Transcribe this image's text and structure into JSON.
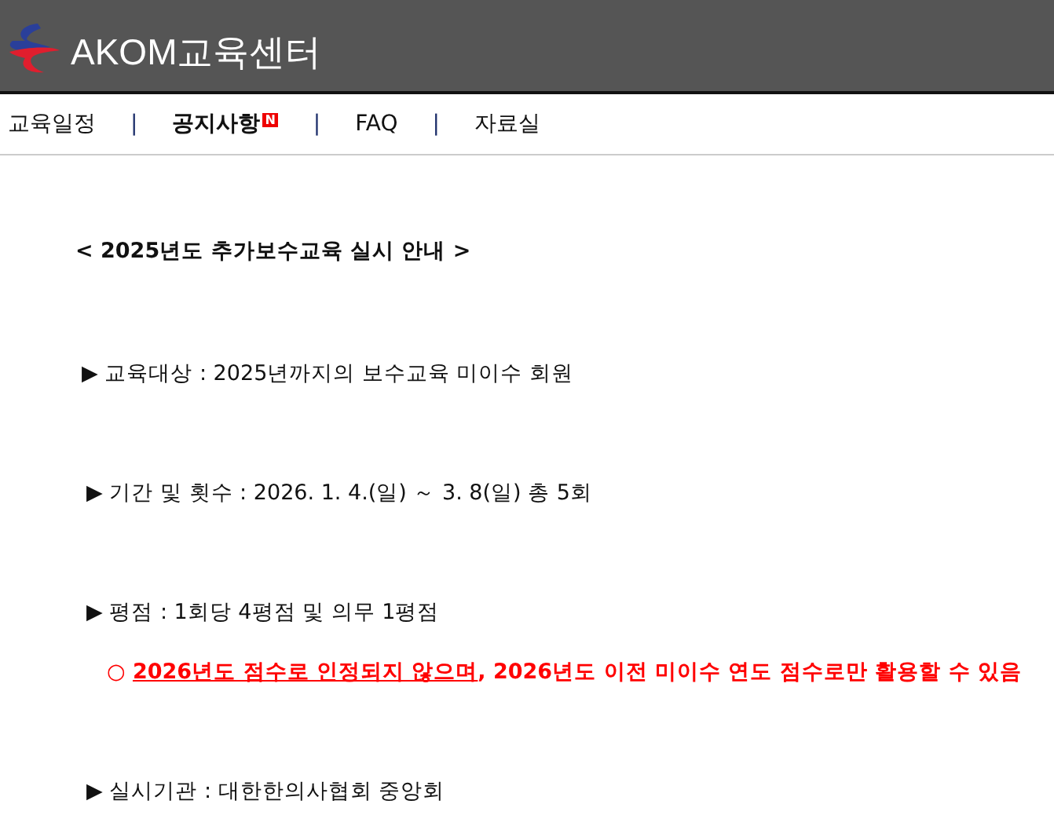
{
  "header": {
    "site_title": "AKOM교육센터"
  },
  "nav": [
    {
      "kind": "link",
      "label": "교육일정",
      "selected": false
    },
    {
      "kind": "separator",
      "text": "|"
    },
    {
      "kind": "link",
      "label": "공지사항",
      "selected": true,
      "badge": "N"
    },
    {
      "kind": "separator",
      "text": "|"
    },
    {
      "kind": "link",
      "label": "FAQ",
      "selected": false
    },
    {
      "kind": "separator",
      "text": "|"
    },
    {
      "kind": "link",
      "label": "자료실",
      "selected": false
    }
  ],
  "notice": {
    "title": "< 2025년도 추가보수교육 실시 안내 >",
    "items": [
      {
        "kind": "item",
        "text": "▶ 교육대상 : 2025년까지의 보수교육 미이수 회원"
      },
      {
        "kind": "item",
        "text": "▶ 기간 및 횟수 : 2026. 1. 4.(일) ～ 3. 8(일) 총 5회"
      },
      {
        "kind": "item",
        "text": "▶ 평점 : 1회당 4평점 및 의무 1평점"
      },
      {
        "kind": "warning",
        "marker": "○",
        "underlined": "2026년도 점수로 인정되지 않으며",
        "rest": ", 2026년도 이전 미이수 연도 점수로만 활용할 수 있음"
      },
      {
        "kind": "item",
        "text": "▶ 실시기관 : 대한한의사협회 중앙회"
      }
    ]
  }
}
